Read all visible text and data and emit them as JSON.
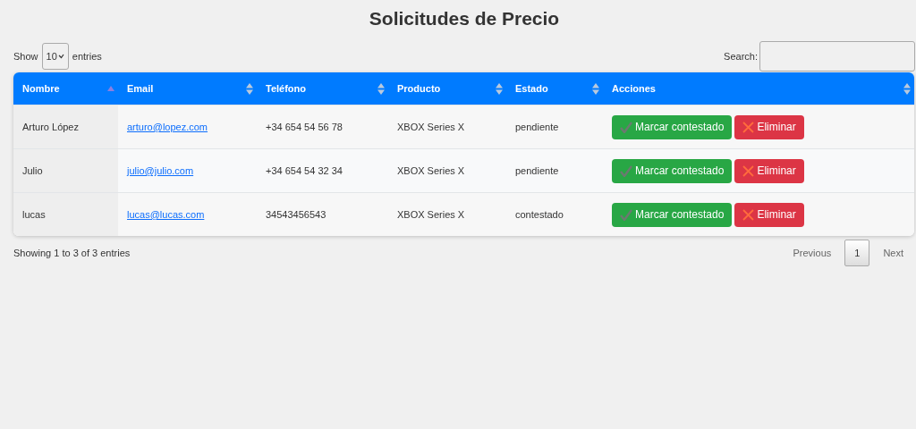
{
  "title": "Solicitudes de Precio",
  "length": {
    "before": "Show",
    "value": "10",
    "after": "entries"
  },
  "search": {
    "label": "Search:"
  },
  "columns": [
    {
      "label": "Nombre",
      "sorted": true
    },
    {
      "label": "Email",
      "sorted": false
    },
    {
      "label": "Teléfono",
      "sorted": false
    },
    {
      "label": "Producto",
      "sorted": false
    },
    {
      "label": "Estado",
      "sorted": false
    },
    {
      "label": "Acciones",
      "sorted": false
    }
  ],
  "rows": [
    {
      "nombre": "Arturo López",
      "email": "arturo@lopez.com",
      "telefono": "+34 654 54 56 78",
      "producto": "XBOX Series X",
      "estado": "pendiente",
      "actions": [
        "Marcar contestado",
        "Eliminar"
      ]
    },
    {
      "nombre": "Julio",
      "email": "julio@julio.com",
      "telefono": "+34 654 54 32 34",
      "producto": "XBOX Series X",
      "estado": "pendiente",
      "actions": [
        "Marcar contestado",
        "Eliminar"
      ]
    },
    {
      "nombre": "lucas",
      "email": "lucas@lucas.com",
      "telefono": "34543456543",
      "producto": "XBOX Series X",
      "estado": "contestado",
      "actions": [
        "Marcar contestado",
        "Eliminar"
      ]
    }
  ],
  "info": "Showing 1 to 3 of 3 entries",
  "pagination": [
    {
      "label": "Previous",
      "selected": false
    },
    {
      "label": "1",
      "selected": true
    },
    {
      "label": "Next",
      "selected": false
    }
  ]
}
